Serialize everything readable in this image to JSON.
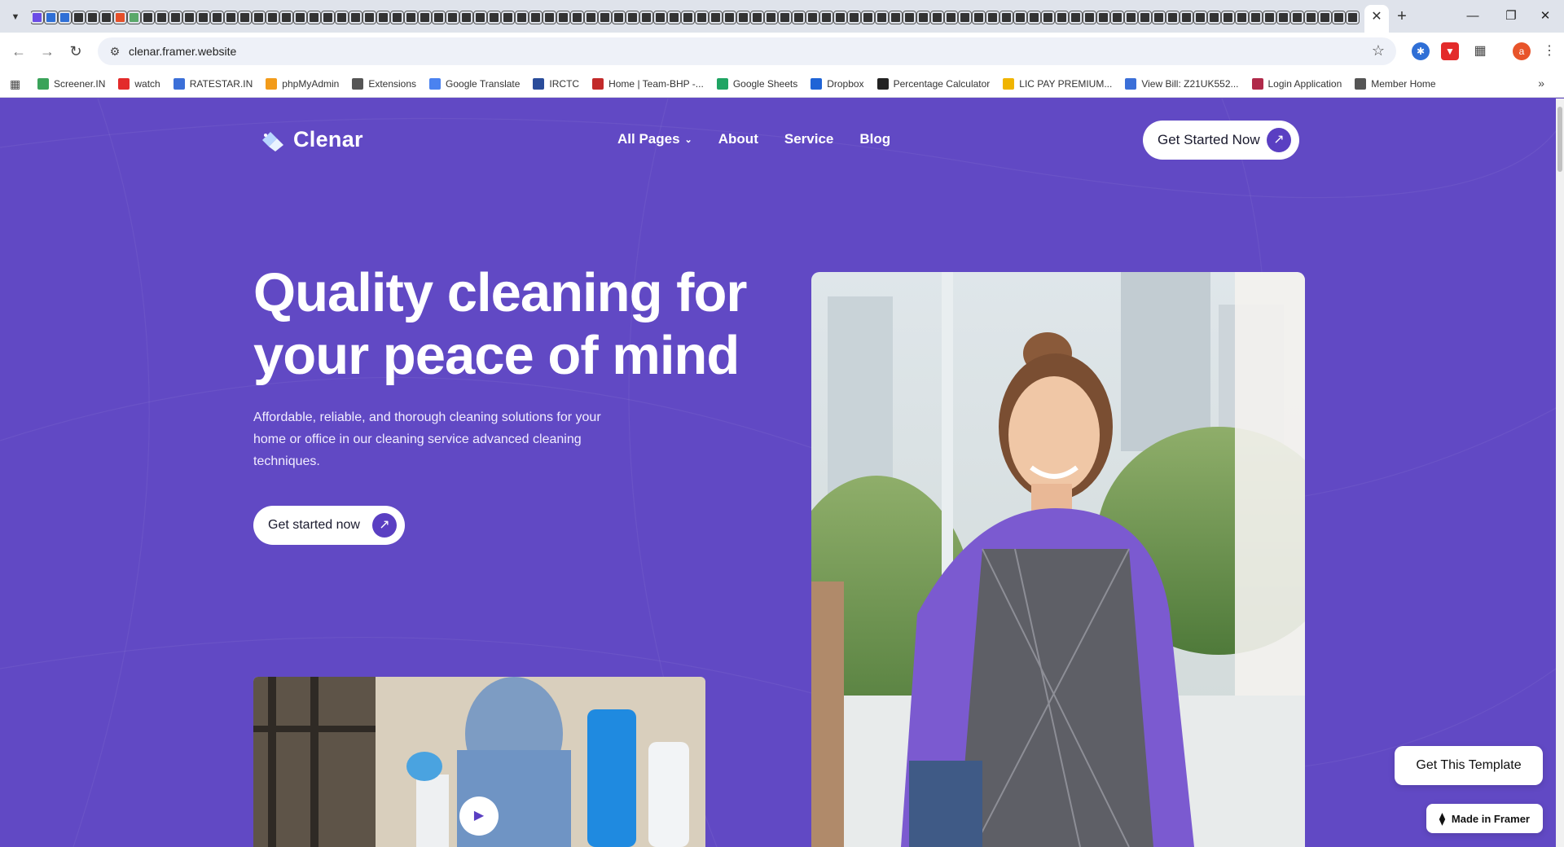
{
  "browser": {
    "url": "clenar.framer.website",
    "bookmarks": [
      {
        "label": "Screener.IN",
        "color": "#3aa35a"
      },
      {
        "label": "watch",
        "color": "#e32b2b"
      },
      {
        "label": "RATESTAR.IN",
        "color": "#3b6fd8"
      },
      {
        "label": "phpMyAdmin",
        "color": "#f29b1a"
      },
      {
        "label": "Extensions",
        "color": "#555555"
      },
      {
        "label": "Google Translate",
        "color": "#4a82f0"
      },
      {
        "label": "IRCTC",
        "color": "#2a4c9a"
      },
      {
        "label": "Home | Team-BHP -...",
        "color": "#c22a2a"
      },
      {
        "label": "Google Sheets",
        "color": "#1fa463"
      },
      {
        "label": "Dropbox",
        "color": "#1f64d6"
      },
      {
        "label": "Percentage Calculator",
        "color": "#222222"
      },
      {
        "label": "LIC PAY PREMIUM...",
        "color": "#f0b400"
      },
      {
        "label": "View Bill: Z21UK552...",
        "color": "#3b6fd8"
      },
      {
        "label": "Login Application",
        "color": "#b02a4a"
      },
      {
        "label": "Member Home",
        "color": "#555555"
      }
    ],
    "profile_initial": "a"
  },
  "site": {
    "logo_text": "Clenar",
    "nav": {
      "all_pages": "All Pages",
      "about": "About",
      "service": "Service",
      "blog": "Blog"
    },
    "top_cta": "Get Started Now",
    "hero": {
      "title_line1": "Quality cleaning for",
      "title_line2": "your peace of mind",
      "description": "Affordable, reliable, and thorough cleaning solutions for your home or office in our cleaning service advanced cleaning techniques.",
      "cta": "Get started now"
    },
    "get_template": "Get This Template",
    "made_in_framer": "Made in Framer"
  },
  "colors": {
    "page_background": "#6149c4",
    "accent": "#5a3fc2"
  }
}
